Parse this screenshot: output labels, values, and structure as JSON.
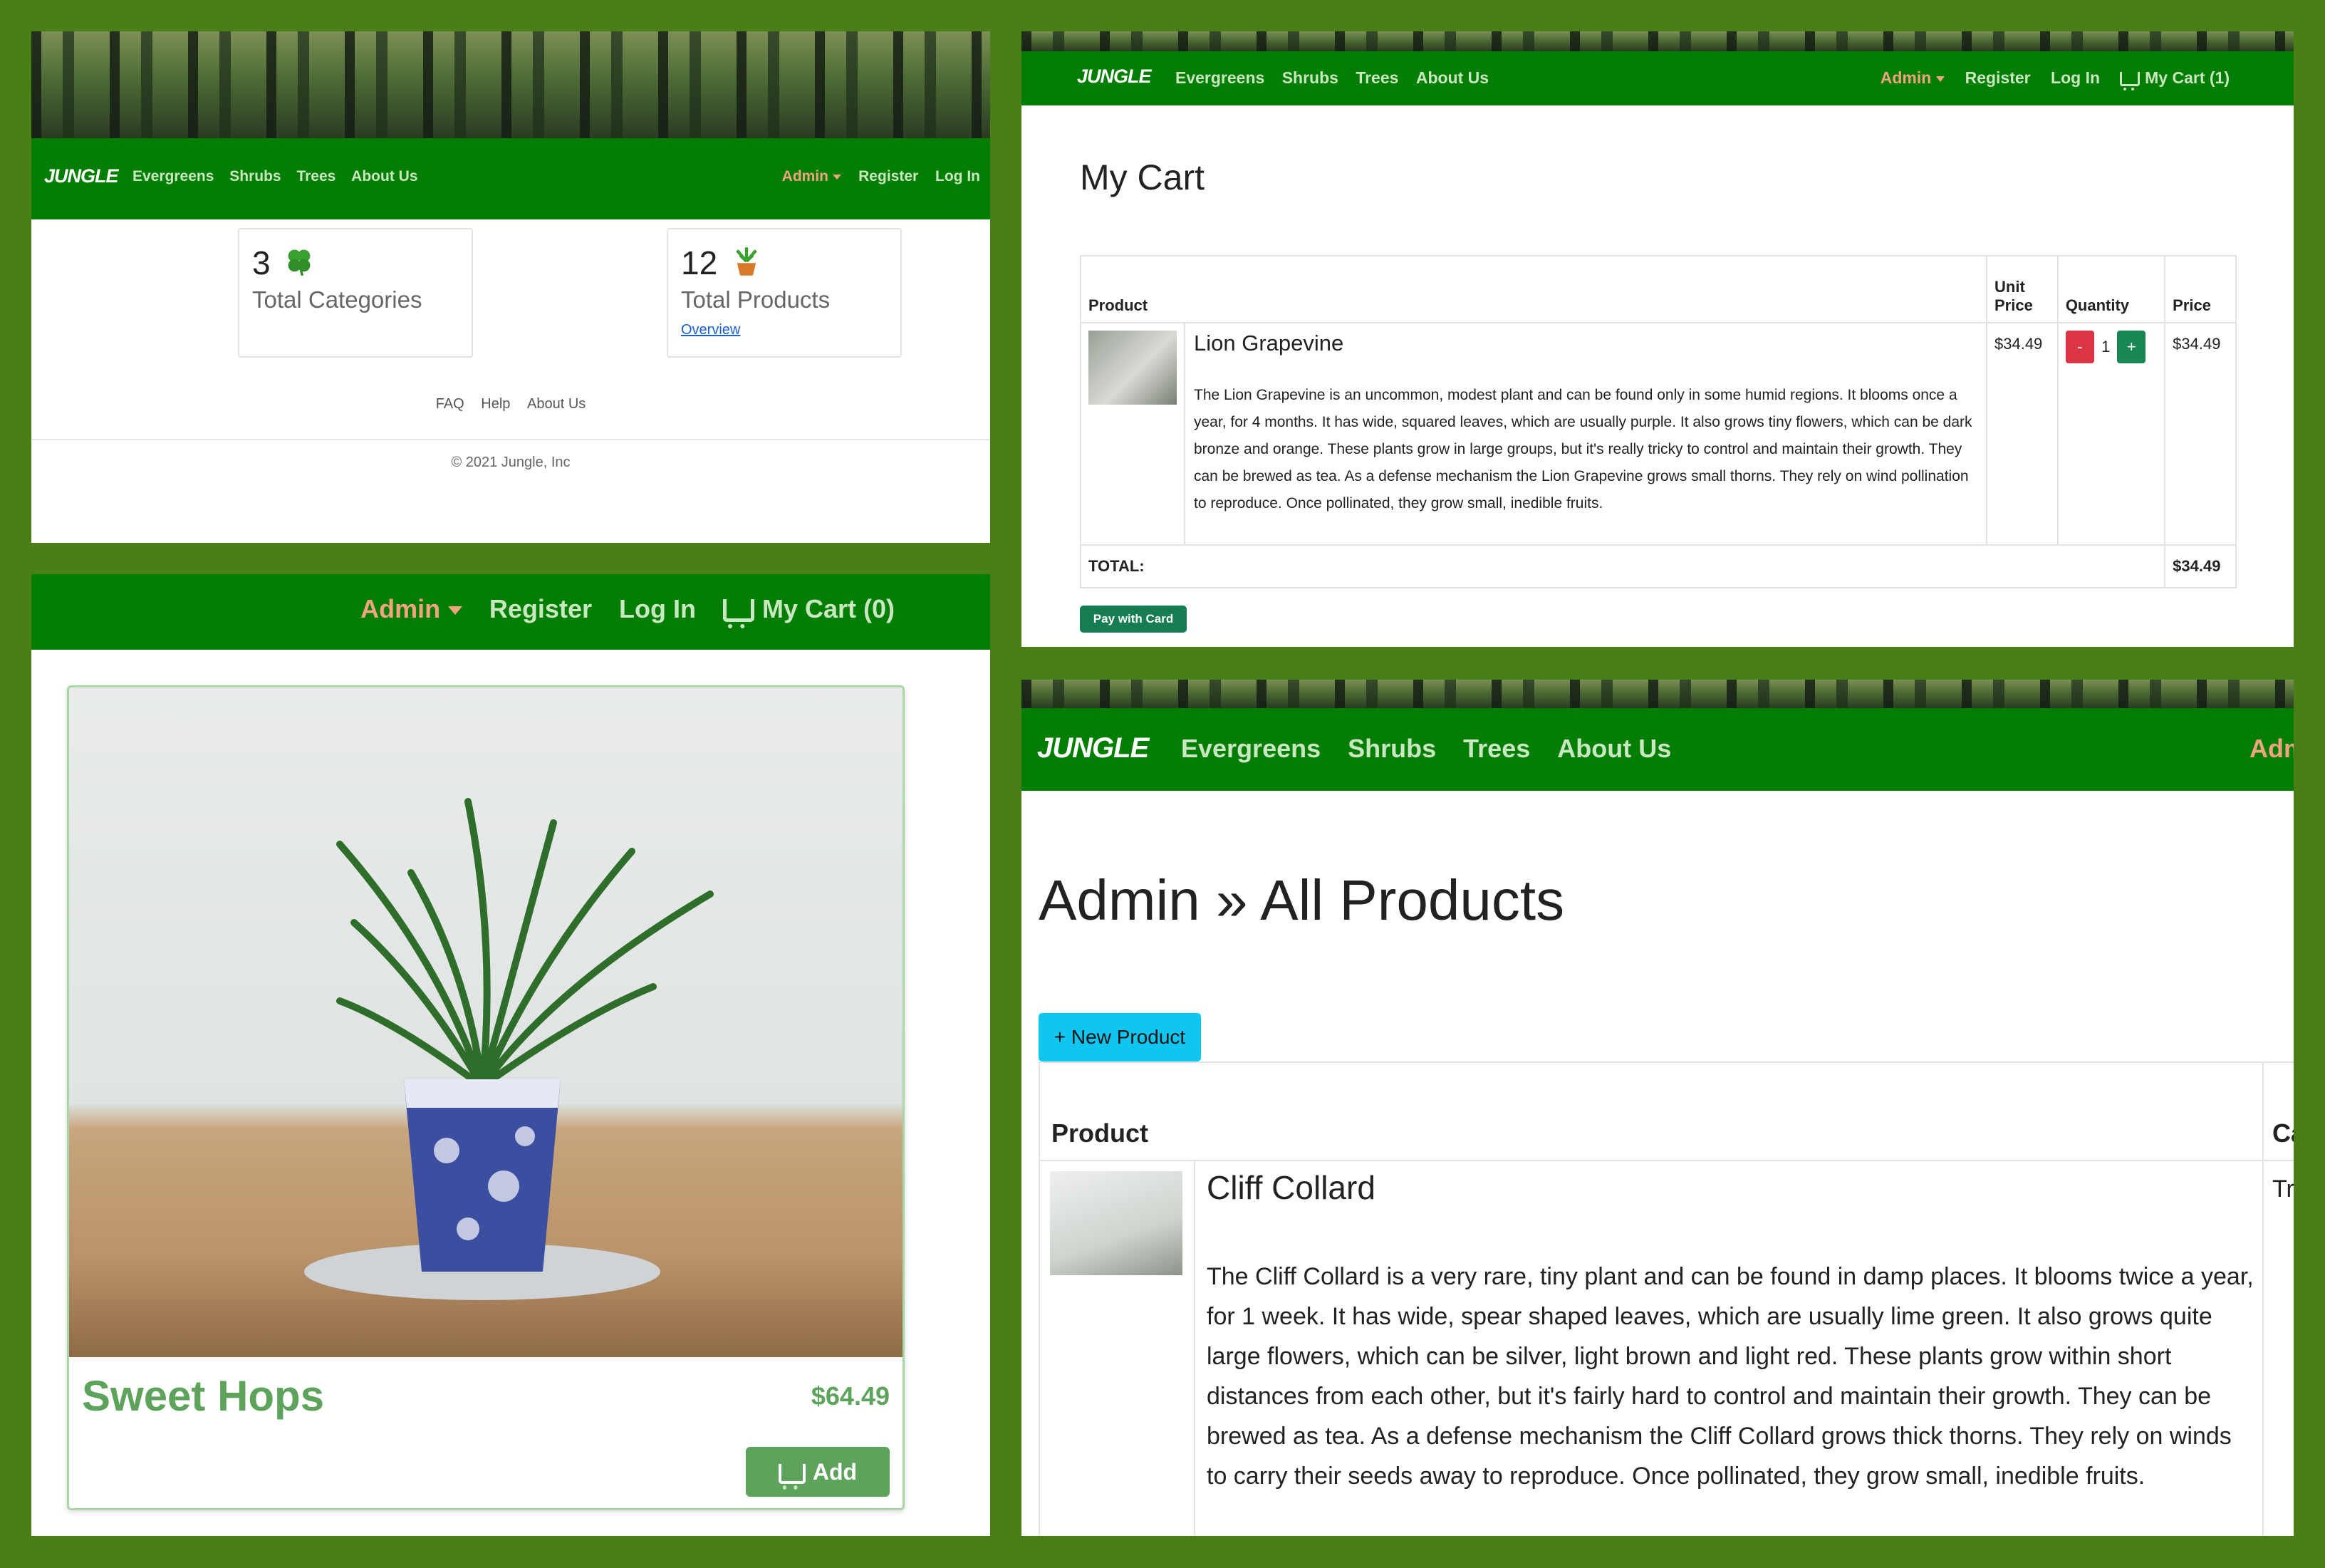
{
  "brand": "JUNGLE",
  "nav_links": [
    "Evergreens",
    "Shrubs",
    "Trees",
    "About Us"
  ],
  "nav_right": {
    "admin": "Admin",
    "register": "Register",
    "login": "Log In"
  },
  "dashboard": {
    "categories_count": "3",
    "categories_label": "Total Categories",
    "products_count": "12",
    "products_label": "Total Products",
    "overview_link": "Overview",
    "footer_links": [
      "FAQ",
      "Help",
      "About Us"
    ],
    "copyright": "© 2021 Jungle, Inc"
  },
  "cart": {
    "cart_link": "My Cart (1)",
    "title": "My Cart",
    "headers": {
      "product": "Product",
      "unit_price_1": "Unit",
      "unit_price_2": "Price",
      "quantity": "Quantity",
      "price": "Price"
    },
    "item": {
      "name": "Lion Grapevine",
      "description": "The Lion Grapevine is an uncommon, modest plant and can be found only in some humid regions. It blooms once a year, for 4 months. It has wide, squared leaves, which are usually purple. It also grows tiny flowers, which can be dark bronze and orange. These plants grow in large groups, but it's really tricky to control and maintain their growth. They can be brewed as tea. As a defense mechanism the Lion Grapevine grows small thorns. They rely on wind pollination to reproduce. Once pollinated, they grow small, inedible fruits.",
      "unit_price": "$34.49",
      "qty": "1",
      "minus": "-",
      "plus": "+",
      "price": "$34.49"
    },
    "total_label": "TOTAL:",
    "total": "$34.49",
    "pay_button": "Pay with Card"
  },
  "product_page": {
    "cart_link": "My Cart (0)",
    "name": "Sweet Hops",
    "price": "$64.49",
    "add_button": "Add"
  },
  "admin": {
    "nav_cut": "Adm",
    "title": "Admin » All Products",
    "new_product": "+ New Product",
    "col_product": "Product",
    "col_cut": "Ca",
    "name": "Cliff Collard",
    "cell_cut": "Tr",
    "description": "The Cliff Collard is a very rare, tiny plant and can be found in damp places. It blooms twice a year, for 1 week. It has wide, spear shaped leaves, which are usually lime green. It also grows quite large flowers, which can be silver, light brown and light red. These plants grow within short distances from each other, but it's fairly hard to control and maintain their growth. They can be brewed as tea. As a defense mechanism the Cliff Collard grows thick thorns. They rely on winds to carry their seeds away to reproduce. Once pollinated, they grow small, inedible fruits."
  },
  "colors": {
    "nav_green": "#037d02",
    "admin_link": "#f0a480",
    "border_green": "#4a7f18",
    "product_green": "#5ea35c",
    "teal": "#0fc6f0",
    "pay_green": "#167c51"
  }
}
